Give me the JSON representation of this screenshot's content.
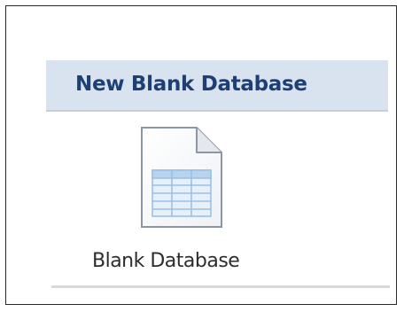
{
  "section": {
    "title": "New Blank Database"
  },
  "templates": [
    {
      "label": "Blank Database",
      "icon": "blank-database-document-icon"
    }
  ],
  "colors": {
    "header_background": "#d9e3ef",
    "header_text": "#1e3f74",
    "label_text": "#2d2d2d",
    "icon_table": "#a8c6e6"
  }
}
